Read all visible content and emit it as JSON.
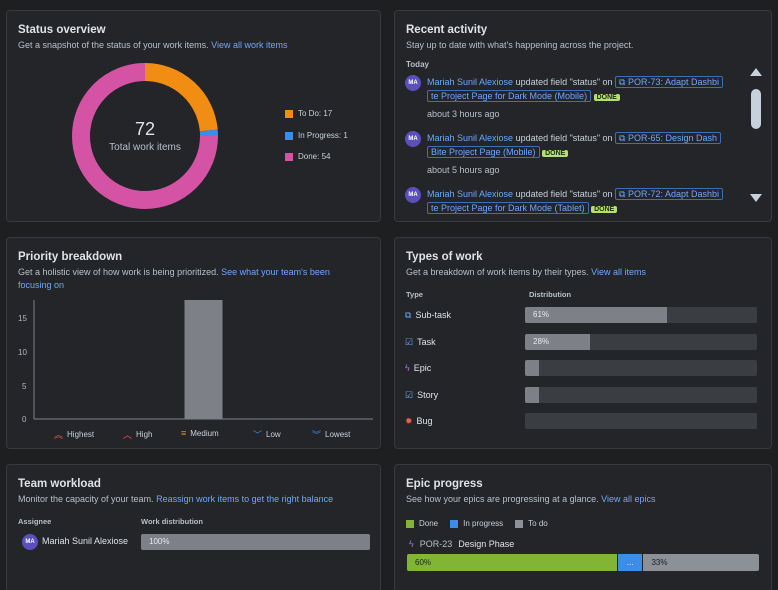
{
  "status_overview": {
    "title": "Status overview",
    "subtitle": "Get a snapshot of the status of your work items.",
    "link": "View all work items",
    "total": "72",
    "total_label": "Total work items",
    "legend": [
      {
        "label": "To Do: 17",
        "value": 17,
        "color": "#f18d13"
      },
      {
        "label": "In Progress: 1",
        "value": 1,
        "color": "#3d8de8"
      },
      {
        "label": "Done: 54",
        "value": 54,
        "color": "#d453a4"
      }
    ]
  },
  "recent_activity": {
    "title": "Recent activity",
    "subtitle": "Stay up to date with what's happening across the project.",
    "group": "Today",
    "items": [
      {
        "avatar": "MA",
        "name": "Mariah Sunil Alexiose",
        "action": "updated field \"status\" on",
        "issue_line1": "POR-73: Adapt Dashbi",
        "issue_line2": "te Project Page for Dark Mode (Mobile)",
        "status": "DONE",
        "time": "about 3 hours ago"
      },
      {
        "avatar": "MA",
        "name": "Mariah Sunil Alexiose",
        "action": "updated field \"status\" on",
        "issue_line1": "POR-65: Design Dash",
        "issue_line2": "Bite Project Page (Mobile)",
        "status": "DONE",
        "time": "about 5 hours ago"
      },
      {
        "avatar": "MA",
        "name": "Mariah Sunil Alexiose",
        "action": "updated field \"status\" on",
        "issue_line1": "POR-72: Adapt Dashbi",
        "issue_line2": "te Project Page for Dark Mode (Tablet)",
        "status": "DONE",
        "time": ""
      }
    ]
  },
  "priority": {
    "title": "Priority breakdown",
    "subtitle_line1": "Get a holistic view of how work is being prioritized.",
    "link_line1": "See what your team's been",
    "link_line2": "focusing on",
    "labels": [
      "Highest",
      "High",
      "Medium",
      "Low",
      "Lowest"
    ]
  },
  "chart_data": {
    "type": "bar",
    "categories": [
      "Highest",
      "High",
      "Medium",
      "Low",
      "Lowest"
    ],
    "values": [
      0,
      0,
      18,
      0,
      0
    ],
    "ylim": [
      0,
      18
    ],
    "yticks": [
      "15",
      "10",
      "5",
      "0"
    ],
    "grid": false
  },
  "types_of_work": {
    "title": "Types of work",
    "subtitle": "Get a breakdown of work items by their types.",
    "link": "View all items",
    "col_type": "Type",
    "col_dist": "Distribution",
    "rows": [
      {
        "label": "Sub-task",
        "icon": "subtask-icon",
        "percent": 61,
        "text": "61%"
      },
      {
        "label": "Task",
        "icon": "task-icon",
        "percent": 28,
        "text": "28%"
      },
      {
        "label": "Epic",
        "icon": "epic-icon",
        "percent": 6,
        "text": ""
      },
      {
        "label": "Story",
        "icon": "story-icon",
        "percent": 6,
        "text": ""
      },
      {
        "label": "Bug",
        "icon": "bug-icon",
        "percent": 0,
        "text": ""
      }
    ]
  },
  "team_workload": {
    "title": "Team workload",
    "subtitle": "Monitor the capacity of your team.",
    "link": "Reassign work items to get the right balance",
    "col_assignee": "Assignee",
    "col_dist": "Work distribution",
    "rows": [
      {
        "avatar": "MA",
        "name": "Mariah Sunil Alexiose",
        "percent": 100,
        "text": "100%"
      }
    ]
  },
  "epic_progress": {
    "title": "Epic progress",
    "subtitle": "See how your epics are progressing at a glance.",
    "link": "View all epics",
    "legend": [
      {
        "label": "Done",
        "color": "#82b536"
      },
      {
        "label": "In progress",
        "color": "#3d8de8"
      },
      {
        "label": "To do",
        "color": "#8c9097"
      }
    ],
    "epic": {
      "key": "POR-23",
      "name": "Design Phase",
      "done_pct": 60,
      "done_text": "60%",
      "inprog_pct": 7,
      "inprog_text": "...",
      "todo_pct": 33,
      "todo_text": "33%"
    }
  }
}
